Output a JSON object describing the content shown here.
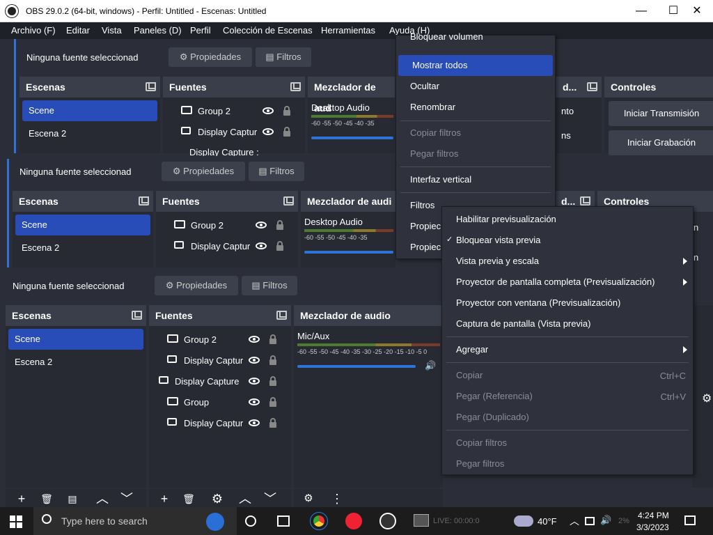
{
  "window": {
    "title": "OBS 29.0.2 (64-bit, windows) - Perfil: Untitled - Escenas: Untitled",
    "minimize": "—",
    "maximize": "☐",
    "close": "✕"
  },
  "menubar": [
    "Archivo (F)",
    "Editar",
    "Vista",
    "Paneles (D)",
    "Perfil",
    "Colección de Escenas",
    "Herramientas",
    "Ayuda (H)"
  ],
  "source_bar": {
    "no_source": "Ninguna fuente seleccionad",
    "props": "Propiedades",
    "filters": "Filtros"
  },
  "docks": {
    "scenes": "Escenas",
    "sources": "Fuentes",
    "mixer": "Mezclador de audio",
    "mixer_cut": "Mezclador de aud",
    "mixer_cut2": "Mezclador de audi",
    "controls": "Controles",
    "trans_cut": "d..."
  },
  "scenes": [
    "Scene",
    "Escena 2"
  ],
  "sources": [
    "Group 2",
    "Display Captur",
    "Display Capture",
    "Group",
    "Display Captur"
  ],
  "sources_cut": "Display Capture :",
  "mixer": {
    "desktop": "Desktop Audio",
    "mic": "Mic/Aux",
    "ticks": "-60 -55 -50 -45 -40 -35 -30 -25 -20 -15 -10 -5 0",
    "ticks_cut": "-60 -55 -50 -45 -40 -35"
  },
  "controls": {
    "stream": "Iniciar Transmisión",
    "record": "Iniciar Grabación",
    "trans_a": "nto",
    "trans_b": "ns",
    "cut_n": "n",
    "cut_n2": "n"
  },
  "top_menu": {
    "partial": "Bloquear volumen",
    "items": [
      "Mostrar todos",
      "Ocultar",
      "Renombrar",
      "Copiar filtros",
      "Pegar filtros",
      "Interfaz vertical",
      "Filtros",
      "Propiec",
      "Propiec"
    ]
  },
  "ctx_menu": {
    "items": [
      "Habilitar previsualización",
      "Bloquear vista previa",
      "Vista previa y escala",
      "Proyector de pantalla completa (Previsualización)",
      "Proyector con ventana (Previsualización)",
      "Captura de pantalla (Vista previa)",
      "Agregar",
      "Copiar",
      "Pegar (Referencia)",
      "Pegar (Duplicado)",
      "Copiar filtros",
      "Pegar filtros"
    ],
    "shortcuts": {
      "copy": "Ctrl+C",
      "paste": "Ctrl+V"
    },
    "check": "✓"
  },
  "status": {
    "live": "LIVE: 00:00:0",
    "rec_pct": "2%"
  },
  "taskbar": {
    "search": "Type here to search",
    "weather": "40°F",
    "time": "4:24 PM",
    "date": "3/3/2023"
  },
  "icons": {
    "gear": "⚙",
    "filter": "▤",
    "plus": "+",
    "trash": "🗑",
    "up": "︿",
    "down": "﹀",
    "dots": "⋮",
    "speaker": "🔊"
  }
}
